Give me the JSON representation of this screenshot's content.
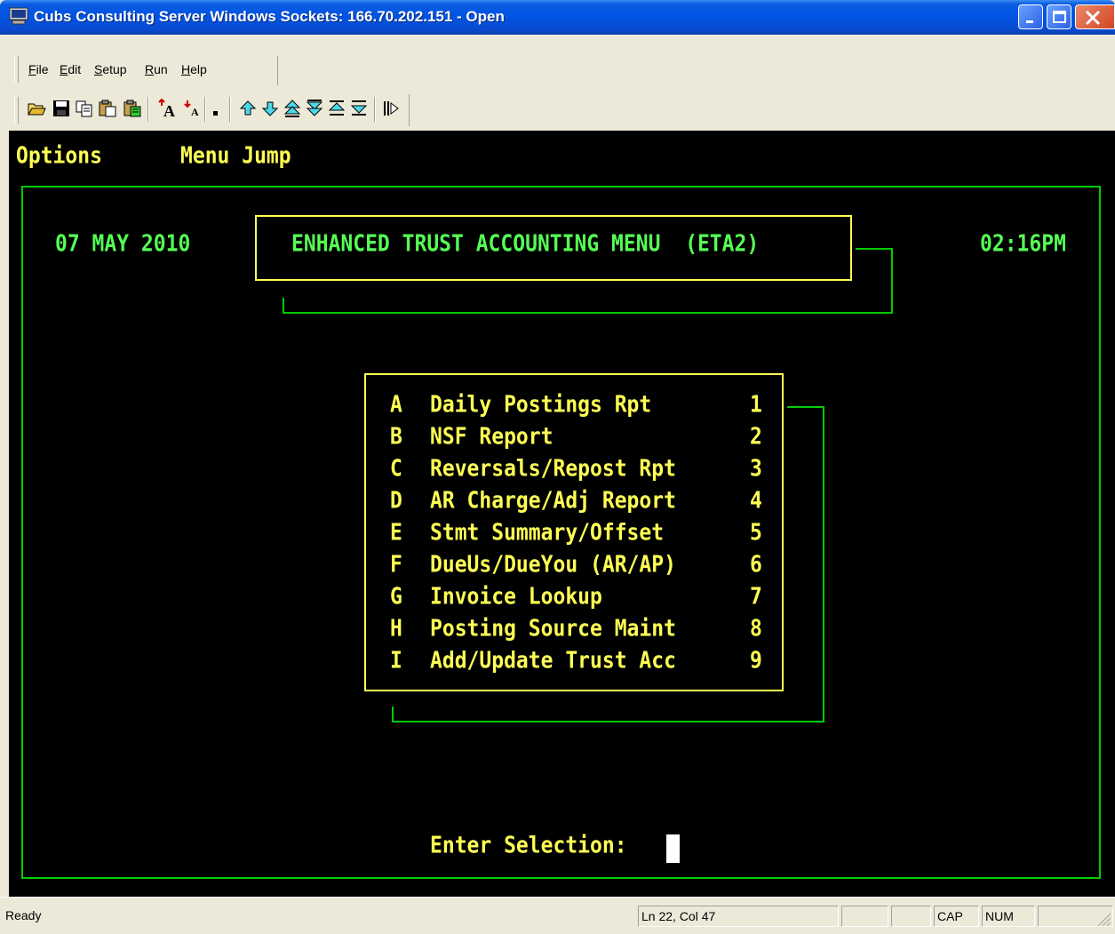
{
  "window": {
    "title": "Cubs Consulting Server Windows Sockets: 166.70.202.151 - Open",
    "icon": "terminal-computer-icon"
  },
  "menubar": {
    "items": [
      {
        "label": "File",
        "hotkey": "F"
      },
      {
        "label": "Edit",
        "hotkey": "E"
      },
      {
        "label": "Setup",
        "hotkey": "S"
      },
      {
        "label": "Run",
        "hotkey": "R"
      },
      {
        "label": "Help",
        "hotkey": "H"
      }
    ]
  },
  "toolbar": {
    "icons": [
      "open-folder-icon",
      "save-disk-icon",
      "copy-icon",
      "paste-icon",
      "paste-special-icon",
      "font-larger-icon",
      "font-smaller-icon",
      "small-dot-icon",
      "arrow-up-icon",
      "arrow-down-icon",
      "page-up-icon",
      "page-down-icon",
      "top-icon",
      "bottom-icon",
      "connect-icon"
    ]
  },
  "terminal": {
    "menu_options": "Options",
    "menu_jump": "Menu Jump",
    "date": "07 MAY 2010",
    "title": "ENHANCED TRUST ACCOUNTING MENU  (ETA2)",
    "time": "02:16PM",
    "items": [
      {
        "letter": "A",
        "label": "Daily Postings Rpt",
        "number": "1"
      },
      {
        "letter": "B",
        "label": "NSF Report",
        "number": "2"
      },
      {
        "letter": "C",
        "label": "Reversals/Repost Rpt",
        "number": "3"
      },
      {
        "letter": "D",
        "label": "AR Charge/Adj Report",
        "number": "4"
      },
      {
        "letter": "E",
        "label": "Stmt Summary/Offset",
        "number": "5"
      },
      {
        "letter": "F",
        "label": "DueUs/DueYou (AR/AP)",
        "number": "6"
      },
      {
        "letter": "G",
        "label": "Invoice Lookup",
        "number": "7"
      },
      {
        "letter": "H",
        "label": "Posting Source Maint",
        "number": "8"
      },
      {
        "letter": "I",
        "label": "Add/Update Trust Acc",
        "number": "9"
      }
    ],
    "prompt": "Enter Selection:"
  },
  "statusbar": {
    "ready": "Ready",
    "position": "Ln 22, Col 47",
    "cap": "CAP",
    "num": "NUM"
  },
  "colors": {
    "terminal_bg": "#000000",
    "text_yellow": "#ffff55",
    "text_green": "#55ff55",
    "border_green": "#00cc00"
  }
}
